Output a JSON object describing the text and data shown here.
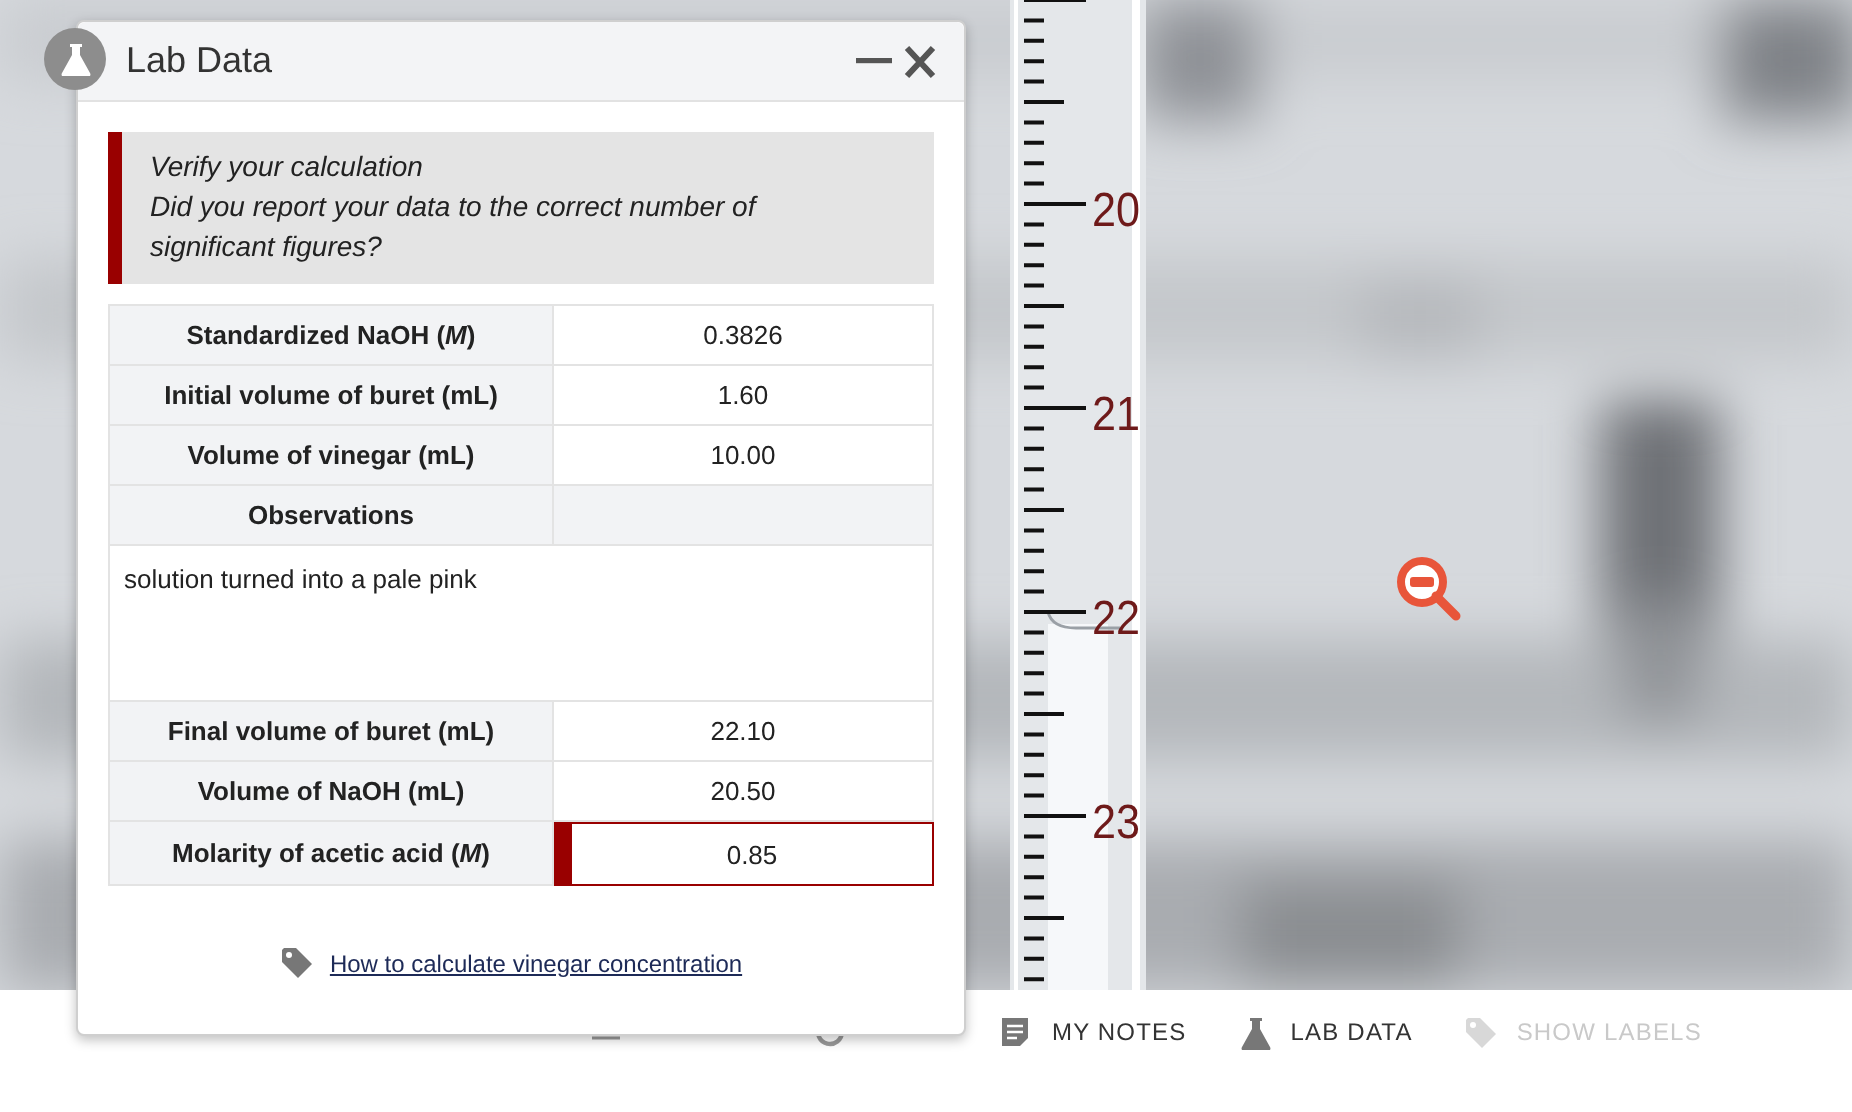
{
  "scene": {
    "buret": {
      "scale_labels": [
        "20",
        "21",
        "22",
        "23"
      ]
    }
  },
  "dialog": {
    "title": "Lab Data",
    "alert": {
      "heading": "Verify your calculation",
      "message": "Did you report your data to the correct number of significant figures?"
    },
    "table": {
      "rows": [
        {
          "kind": "field",
          "label": "Standardized NaOH (*M*)",
          "value": "0.3826"
        },
        {
          "kind": "field",
          "label": "Initial volume of buret (mL)",
          "value": "1.60"
        },
        {
          "kind": "field",
          "label": "Volume of vinegar (mL)",
          "value": "10.00"
        },
        {
          "kind": "heading",
          "label": "Observations"
        },
        {
          "kind": "note",
          "text": "solution turned into a pale pink"
        },
        {
          "kind": "field",
          "label": "Final volume of buret (mL)",
          "value": "22.10"
        },
        {
          "kind": "field",
          "label": "Volume of NaOH (mL)",
          "value": "20.50"
        },
        {
          "kind": "answer",
          "label": "Molarity of acetic acid (*M*)",
          "value": "0.85",
          "flagged": true
        }
      ]
    },
    "link": "How to calculate vinegar concentration"
  },
  "toolbar": {
    "items": [
      {
        "kind": "list"
      },
      {
        "kind": "reset"
      },
      {
        "kind": "notes",
        "label": "MY NOTES",
        "disabled": false
      },
      {
        "kind": "flask",
        "label": "LAB DATA",
        "disabled": false
      },
      {
        "kind": "tag",
        "label": "SHOW LABELS",
        "disabled": true
      }
    ]
  }
}
